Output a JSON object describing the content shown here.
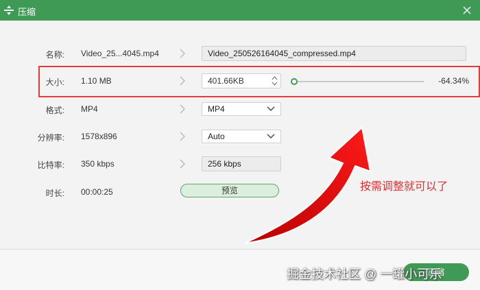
{
  "window": {
    "title": "压缩"
  },
  "rows": {
    "name": {
      "label": "名称:",
      "value": "Video_25...4045.mp4",
      "output": "Video_250526164045_compressed.mp4"
    },
    "size": {
      "label": "大小:",
      "value": "1.10 MB",
      "output": "401.66KB",
      "percent": "-64.34%",
      "slider_fraction": 0.0
    },
    "format": {
      "label": "格式:",
      "value": "MP4",
      "output": "MP4"
    },
    "resolution": {
      "label": "分辨率:",
      "value": "1578x896",
      "output": "Auto"
    },
    "bitrate": {
      "label": "比特率:",
      "value": "350 kbps",
      "output": "256 kbps"
    },
    "duration": {
      "label": "时长:",
      "value": "00:00:25"
    }
  },
  "buttons": {
    "preview": "预览",
    "compress": "压缩"
  },
  "annotation": {
    "text": "按需调整就可以了"
  },
  "watermark": {
    "text": "掘金技术社区 @ 一罐小可乐"
  },
  "colors": {
    "accent": "#3f9a55",
    "highlight": "#e33b3b",
    "annotation": "#e62c2c"
  }
}
